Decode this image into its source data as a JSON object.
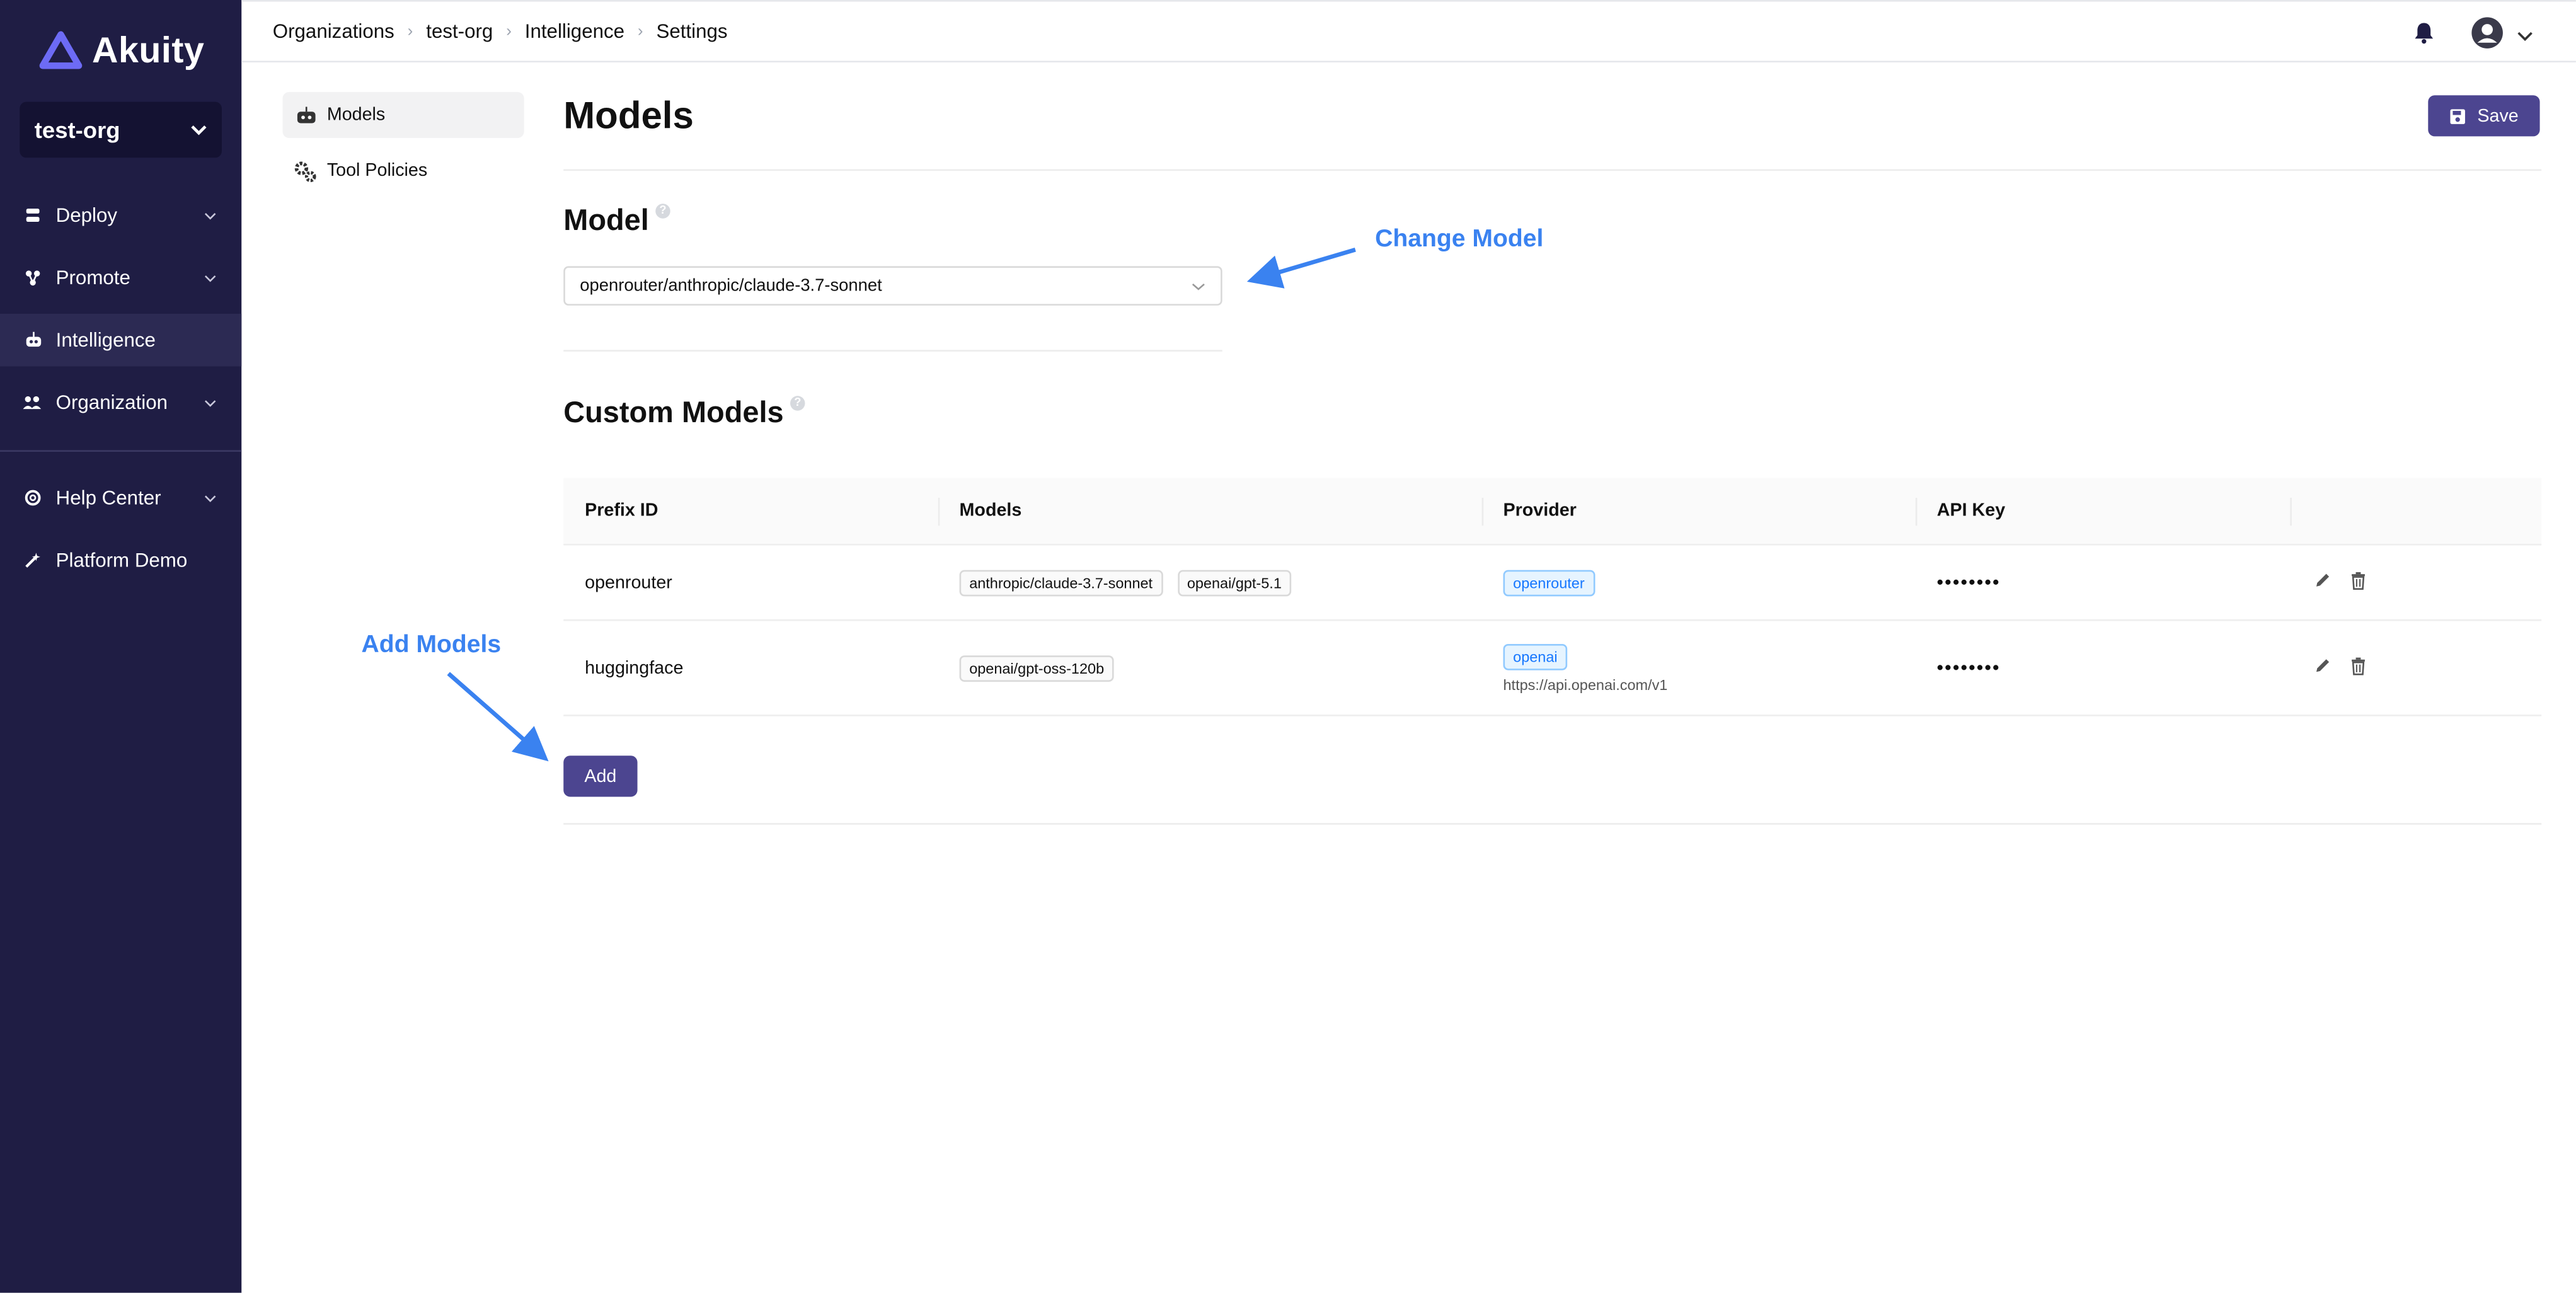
{
  "brand": {
    "name": "Akuity",
    "accent": "#4c4590",
    "sidebar_bg": "#1f1d44"
  },
  "org_selector": {
    "value": "test-org"
  },
  "sidebar": {
    "items": [
      {
        "label": "Deploy",
        "icon": "deploy-icon"
      },
      {
        "label": "Promote",
        "icon": "promote-icon"
      },
      {
        "label": "Intelligence",
        "icon": "robot-icon"
      },
      {
        "label": "Organization",
        "icon": "people-icon"
      },
      {
        "label": "Help Center",
        "icon": "lifebuoy-icon"
      },
      {
        "label": "Platform Demo",
        "icon": "wand-icon"
      }
    ]
  },
  "breadcrumb": [
    "Organizations",
    "test-org",
    "Intelligence",
    "Settings"
  ],
  "subnav": {
    "items": [
      {
        "label": "Models"
      },
      {
        "label": "Tool Policies"
      }
    ]
  },
  "page": {
    "title": "Models",
    "save_label": "Save"
  },
  "model_section": {
    "title": "Model",
    "selected_model": "openrouter/anthropic/claude-3.7-sonnet"
  },
  "custom_models": {
    "title": "Custom Models",
    "columns": [
      "Prefix ID",
      "Models",
      "Provider",
      "API Key"
    ],
    "rows": [
      {
        "prefix_id": "openrouter",
        "models": [
          "anthropic/claude-3.7-sonnet",
          "openai/gpt-5.1"
        ],
        "provider": "openrouter",
        "provider_url": "",
        "api_key": "••••••••"
      },
      {
        "prefix_id": "huggingface",
        "models": [
          "openai/gpt-oss-120b"
        ],
        "provider": "openai",
        "provider_url": "https://api.openai.com/v1",
        "api_key": "••••••••"
      }
    ],
    "add_label": "Add"
  },
  "annotations": {
    "change_model": "Change Model",
    "add_models": "Add Models",
    "color": "#3a82f0"
  }
}
